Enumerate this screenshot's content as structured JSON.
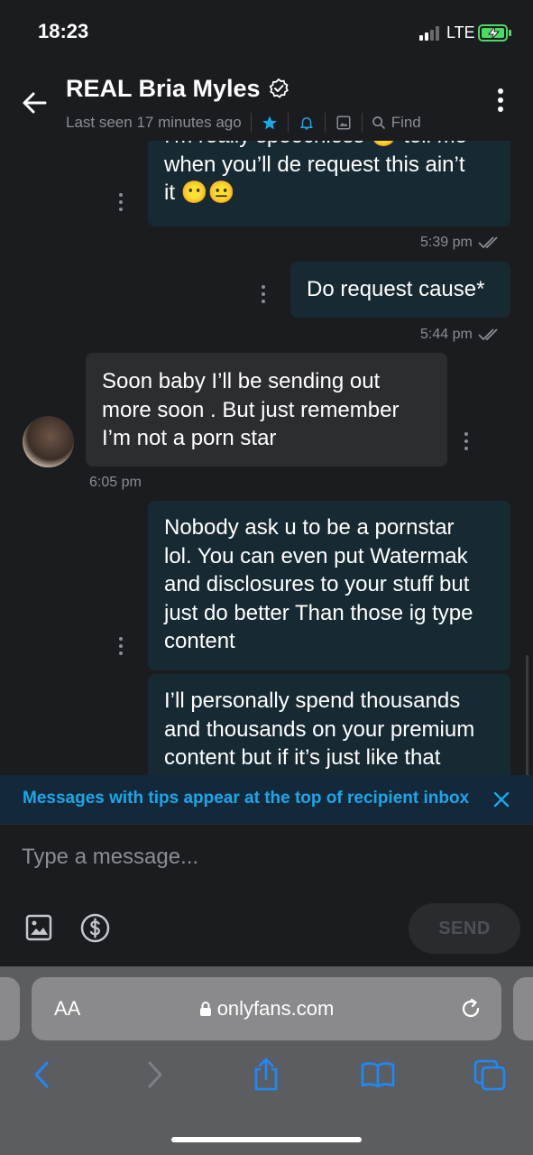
{
  "status_bar": {
    "time": "18:23",
    "network": "LTE"
  },
  "header": {
    "title": "REAL Bria Myles",
    "last_seen": "Last seen 17 minutes ago",
    "find_label": "Find"
  },
  "messages": [
    {
      "id": "m1",
      "direction": "outgoing",
      "lines": [
        "I'm really speechless 😑 tell me",
        "when you’ll de request this ain’t",
        "it 😶😐"
      ],
      "time": "5:39 pm",
      "read": true
    },
    {
      "id": "m2",
      "direction": "outgoing",
      "lines": [
        "Do request cause*"
      ],
      "time": "5:44 pm",
      "read": true
    },
    {
      "id": "m3",
      "direction": "incoming",
      "lines": [
        "Soon baby I’ll be sending out",
        "more soon . But just remember",
        "I’m not a porn star"
      ],
      "time": "6:05 pm"
    },
    {
      "id": "m4",
      "direction": "outgoing",
      "lines": [
        "Nobody ask u to be a pornstar",
        "lol. You can even put Watermak",
        "and disclosures to your stuff but",
        "just do better Than those ig type",
        "content"
      ]
    },
    {
      "id": "m5",
      "direction": "outgoing",
      "lines": [
        "I’ll personally spend thousands",
        "and thousands on your premium",
        "content but if it’s just like that"
      ]
    }
  ],
  "tip_banner": {
    "text": "Messages with tips appear at the top of recipient inbox"
  },
  "composer": {
    "placeholder": "Type a message...",
    "send_label": "SEND"
  },
  "browser": {
    "aa_label": "AA",
    "url": "onlyfans.com"
  },
  "colors": {
    "accent": "#1aa7e8",
    "background": "#1b1c1f",
    "outgoing_bubble": "#172a33",
    "incoming_bubble": "#2c2d31",
    "muted_text": "#8a8d93"
  }
}
